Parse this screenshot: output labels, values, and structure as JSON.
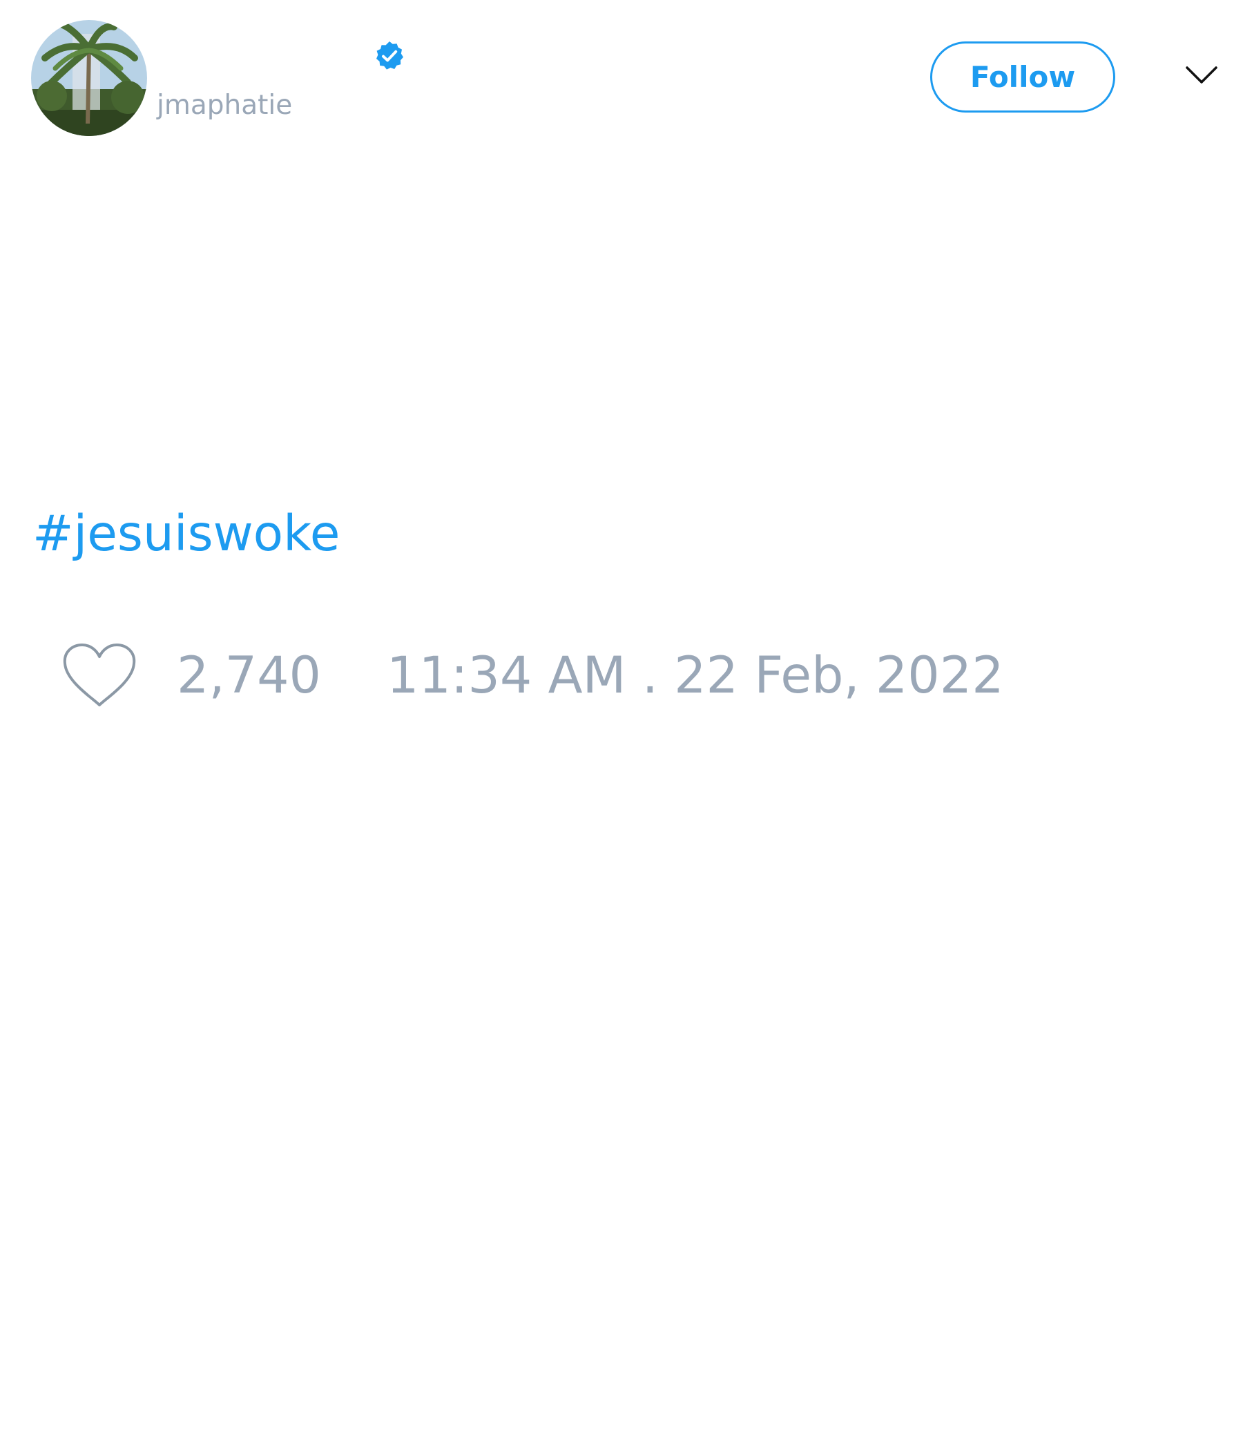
{
  "author": {
    "handle": "jmaphatie",
    "verified": true,
    "avatar_icon": "palm-tree-photo"
  },
  "header": {
    "follow_label": "Follow",
    "menu_icon": "chevron-down-icon"
  },
  "tweet": {
    "hashtag": "#jesuiswoke"
  },
  "footer": {
    "like_icon": "heart-outline-icon",
    "like_count": "2,740",
    "timestamp": "11:34 AM . 22 Feb, 2022"
  },
  "colors": {
    "accent": "#1d9bf0",
    "muted_text": "#9aa7b7",
    "icon_gray": "#8b98a5",
    "background": "#ffffff"
  }
}
